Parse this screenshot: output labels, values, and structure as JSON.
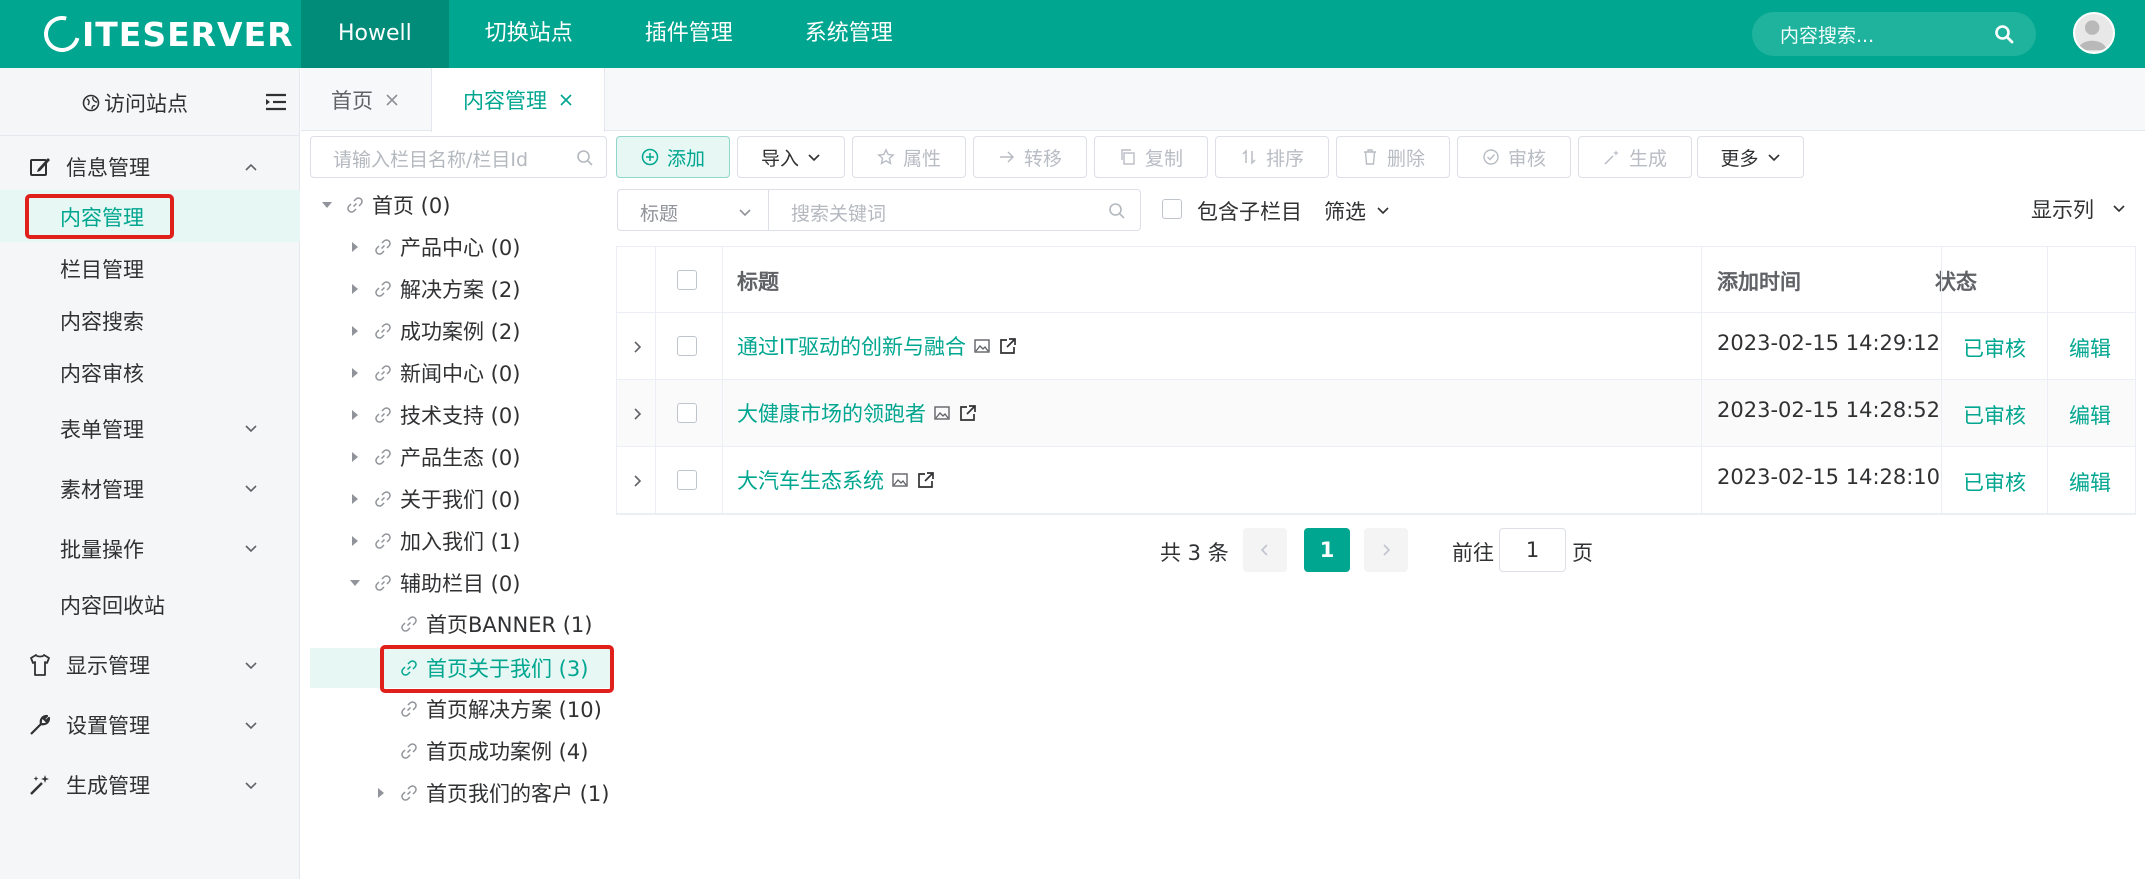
{
  "app": {
    "logo": "ITESERVER",
    "brand_color": "#00a68f",
    "nav": [
      "Howell",
      "切换站点",
      "插件管理",
      "系统管理"
    ],
    "search_placeholder": "内容搜索..."
  },
  "sidebar": {
    "visit_site": "访问站点",
    "groups": [
      {
        "label": "信息管理",
        "icon": "edit-icon",
        "expanded": true
      },
      {
        "label": "显示管理",
        "icon": "shirt-icon",
        "expanded": false
      },
      {
        "label": "设置管理",
        "icon": "wrench-icon",
        "expanded": false
      },
      {
        "label": "生成管理",
        "icon": "magic-wand-icon",
        "expanded": false
      }
    ],
    "items": [
      "内容管理",
      "栏目管理",
      "内容搜索",
      "内容审核",
      "表单管理",
      "素材管理",
      "批量操作",
      "内容回收站"
    ]
  },
  "tabs": [
    {
      "label": "首页",
      "active": false
    },
    {
      "label": "内容管理",
      "active": true
    }
  ],
  "tree": {
    "search_placeholder": "请输入栏目名称/栏目Id",
    "nodes": [
      {
        "label": "首页 (0)"
      },
      {
        "label": "产品中心 (0)"
      },
      {
        "label": "解决方案 (2)"
      },
      {
        "label": "成功案例 (2)"
      },
      {
        "label": "新闻中心 (0)"
      },
      {
        "label": "技术支持 (0)"
      },
      {
        "label": "产品生态 (0)"
      },
      {
        "label": "关于我们 (0)"
      },
      {
        "label": "加入我们 (1)"
      },
      {
        "label": "辅助栏目 (0)"
      },
      {
        "label": "首页BANNER (1)"
      },
      {
        "label": "首页关于我们 (3)",
        "selected": true
      },
      {
        "label": "首页解决方案 (10)"
      },
      {
        "label": "首页成功案例 (4)"
      },
      {
        "label": "首页我们的客户 (1)"
      }
    ]
  },
  "toolbar": {
    "add": "添加",
    "import": "导入",
    "attributes": "属性",
    "transfer": "转移",
    "copy": "复制",
    "sort": "排序",
    "delete": "删除",
    "audit": "审核",
    "generate": "生成",
    "more": "更多"
  },
  "filter": {
    "field": "标题",
    "keyword_placeholder": "搜索关键词",
    "include_children": "包含子栏目",
    "filter_label": "筛选",
    "columns_label": "显示列"
  },
  "table": {
    "headers": [
      "标题",
      "添加时间",
      "状态"
    ],
    "rows": [
      {
        "title": "通过IT驱动的创新与融合",
        "time": "2023-02-15 14:29:12",
        "status": "已审核",
        "action": "编辑"
      },
      {
        "title": "大健康市场的领跑者",
        "time": "2023-02-15 14:28:52",
        "status": "已审核",
        "action": "编辑"
      },
      {
        "title": "大汽车生态系统",
        "time": "2023-02-15 14:28:10",
        "status": "已审核",
        "action": "编辑"
      }
    ]
  },
  "pagination": {
    "total": "共 3 条",
    "current": "1",
    "goto_label": "前往",
    "goto_value": "1",
    "page_suffix": "页"
  }
}
